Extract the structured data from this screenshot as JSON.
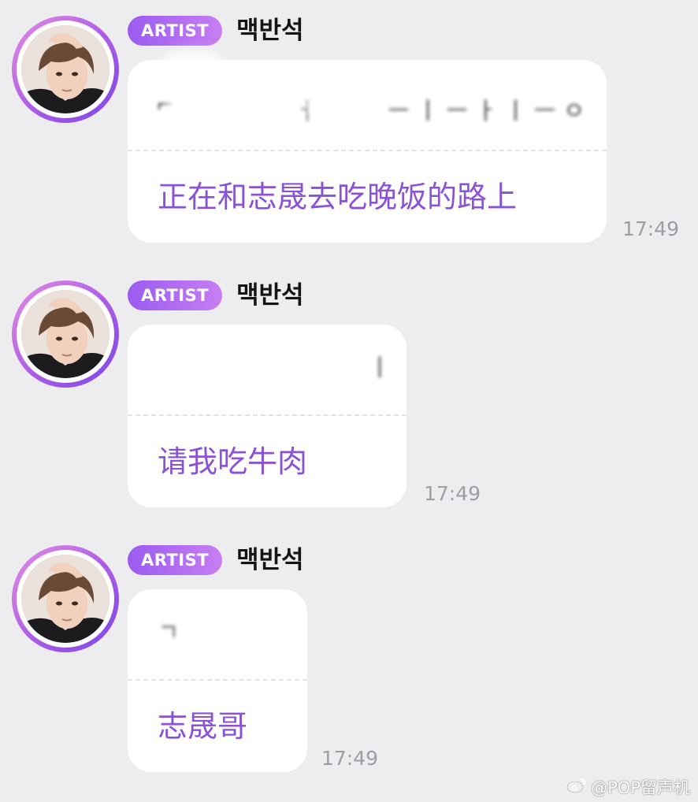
{
  "messages": [
    {
      "badge": "ARTIST",
      "sender": "맥반석",
      "translation": "正在和志晟去吃晚饭的路上",
      "time": "17:49"
    },
    {
      "badge": "ARTIST",
      "sender": "맥반석",
      "translation": "请我吃牛肉",
      "time": "17:49"
    },
    {
      "badge": "ARTIST",
      "sender": "맥반석",
      "translation": "志晟哥",
      "time": "17:49"
    }
  ],
  "watermark": "@POP留声机",
  "colors": {
    "background": "#ededef",
    "bubble": "#ffffff",
    "translation_text": "#8a53d6",
    "badge_gradient_start": "#9a5cf0",
    "badge_gradient_end": "#c77ef2",
    "timestamp": "#9d9da3"
  },
  "icons": {
    "avatar": "artist-avatar-photo",
    "watermark": "weibo-logo-icon"
  }
}
